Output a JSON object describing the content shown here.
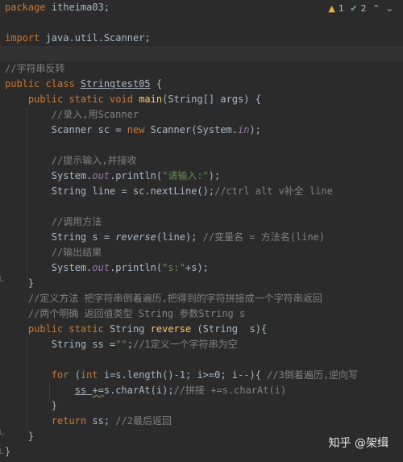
{
  "inspections": {
    "warnings": "1",
    "weak_warnings": "2"
  },
  "code": {
    "l1_kw": "package",
    "l1_rest": " itheima03;",
    "l2_kw": "import",
    "l2_rest": " java.util.Scanner;",
    "l3_comment": "//字符串反转",
    "l4_kw": "public class ",
    "l4_cls": "Stringtest05",
    "l4_rest": " {",
    "l5_kw": "public static void ",
    "l5_fn": "main",
    "l5_rest": "(String[] args) {",
    "l6_comment": "//录入,用Scanner",
    "l7_a": "Scanner sc = ",
    "l7_kw": "new",
    "l7_b": " Scanner(System.",
    "l7_in": "in",
    "l7_c": ");",
    "l8_comment": "//提示输入,并接收",
    "l9_a": "System.",
    "l9_out": "out",
    "l9_b": ".println(",
    "l9_str": "\"请输入:\"",
    "l9_c": ");",
    "l10_a": "String line = sc.nextLine();",
    "l10_comment": "//ctrl alt v补全 line",
    "l11_comment": "//调用方法",
    "l12_a": "String s = ",
    "l12_call": "reverse",
    "l12_b": "(line); ",
    "l12_comment": "//变量名 = 方法名(line)",
    "l13_comment": "//输出结果",
    "l14_a": "System.",
    "l14_out": "out",
    "l14_b": ".println(",
    "l14_str": "\"s:\"",
    "l14_c": "+s);",
    "l15": "}",
    "l16_comment": "//定义方法 把字符串倒着遍历,把得到的字符拼接成一个字符串返回",
    "l17_comment": "//两个明确 返回值类型 String 参数String s",
    "l18_kw": "public static ",
    "l18_a": "String ",
    "l18_fn": "reverse",
    "l18_b": " (String  s){",
    "l19_a": "String ss =",
    "l19_str": "\"\"",
    "l19_b": ";",
    "l19_comment": "//1定义一个字符串为空",
    "l20_kw": "for",
    "l20_a": " (",
    "l20_kw2": "int",
    "l20_b": " i=s.length()-1; i>=0; i--){ ",
    "l20_comment": "//3倒着遍历,逆向写",
    "l21_a": "ss ",
    "l21_op": "+=",
    "l21_b": "s.charAt(i);",
    "l21_comment": "//拼接 +=s.charAt(i)",
    "l22": "}",
    "l23_kw": "return",
    "l23_a": " ss; ",
    "l23_comment": "//2最后返回",
    "l24": "}",
    "l25": "}"
  },
  "watermark": "知乎 @架缉",
  "colors": {
    "background": "#2b2b2b",
    "keyword": "#cc7832",
    "comment": "#808080",
    "string": "#6a8759",
    "method": "#ffc66d",
    "field": "#9876aa"
  }
}
